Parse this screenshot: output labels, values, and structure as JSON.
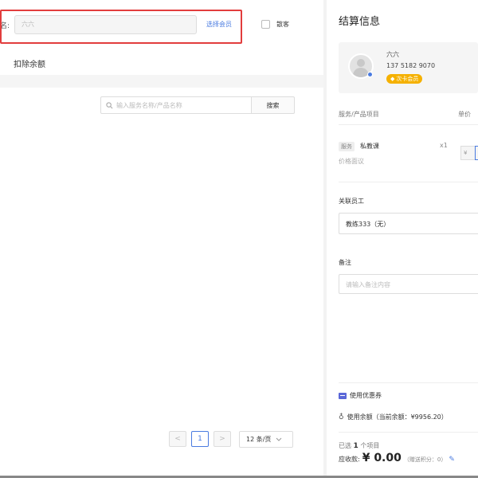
{
  "member": {
    "label": "名:",
    "input_value": "六六",
    "select_link": "选择会员",
    "checkbox_label": "散客"
  },
  "left": {
    "deduct_label": "扣除余额",
    "search_placeholder": "输入服务名称/产品名称",
    "search_button": "搜索",
    "pagination": {
      "prev": "<",
      "current": "1",
      "next": ">",
      "page_size": "12 条/页"
    }
  },
  "checkout": {
    "title": "结算信息",
    "member_card": {
      "name": "六六",
      "phone": "137 5182 9070",
      "badge": "次卡会员"
    },
    "table_header": {
      "item": "服务/产品项目",
      "unit_price": "单价"
    },
    "item": {
      "tag": "服务",
      "name": "私教课",
      "qty": "x1",
      "price_note": "价格面议",
      "currency": "¥"
    },
    "staff": {
      "label": "关联员工",
      "value": "教练333（无）"
    },
    "notes": {
      "label": "备注",
      "placeholder": "请输入备注内容"
    },
    "coupon_label": "使用优惠券",
    "balance_label": "使用余额（当前余额：¥9956.20）",
    "selected_prefix": "已选",
    "selected_count": "1",
    "selected_suffix": "个项目",
    "amount_label": "应收款:",
    "amount_value": "¥ 0.00",
    "points_note": "（赠送积分：0）"
  },
  "colors": {
    "accent": "#4a7be0",
    "highlight": "#e23d3d",
    "badge": "#f5b100"
  },
  "icons": {
    "search": "search-icon",
    "coupon": "coupon-icon",
    "balance": "balance-icon",
    "edit": "edit-icon",
    "chevron": "chevron-down-icon"
  }
}
